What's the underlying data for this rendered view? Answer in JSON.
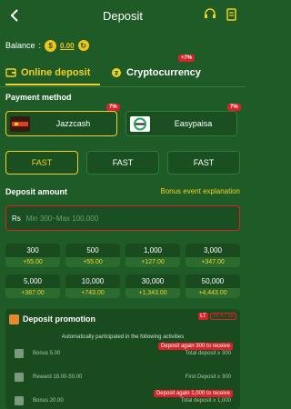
{
  "header": {
    "title": "Deposit"
  },
  "balance": {
    "label": "Balance",
    "value": "0.00"
  },
  "tabs": {
    "online": "Online deposit",
    "crypto": "Cryptocurrency",
    "crypto_badge": "+7%"
  },
  "payment": {
    "label": "Payment method",
    "methods": [
      {
        "name": "Jazzcash",
        "badge": "7%"
      },
      {
        "name": "Easypaisa",
        "badge": "7%"
      }
    ]
  },
  "channels": [
    "FAST",
    "FAST",
    "FAST"
  ],
  "deposit": {
    "label": "Deposit amount",
    "bonus_link": "Bonus event explanation",
    "currency": "Rs",
    "placeholder": "Min 300~Max 100,000"
  },
  "amounts": [
    {
      "value": "300",
      "bonus": "+55.00"
    },
    {
      "value": "500",
      "bonus": "+55.00"
    },
    {
      "value": "1,000",
      "bonus": "+127.00"
    },
    {
      "value": "3,000",
      "bonus": "+347.00"
    },
    {
      "value": "5,000",
      "bonus": "+387.00"
    },
    {
      "value": "10,000",
      "bonus": "+743.00"
    },
    {
      "value": "30,000",
      "bonus": "+1,343.00"
    },
    {
      "value": "50,000",
      "bonus": "+4,443.00"
    }
  ],
  "promo": {
    "title": "Deposit promotion",
    "lt": "LT",
    "timer": "04:47:18",
    "subtitle": "Automatically participated in the following activities",
    "rows": [
      {
        "left": "Bonus 5.00",
        "right": "Total deposit ≥ 300",
        "badge": "Deposit again 300 to receive"
      },
      {
        "left": "Reward 18.00-50.00",
        "right": "First Deposit ≥ 300",
        "badge": ""
      },
      {
        "left": "Bonus 20.00",
        "right": "Total deposit ≥ 1,000",
        "badge": "Deposit again 1,000 to receive"
      }
    ]
  }
}
